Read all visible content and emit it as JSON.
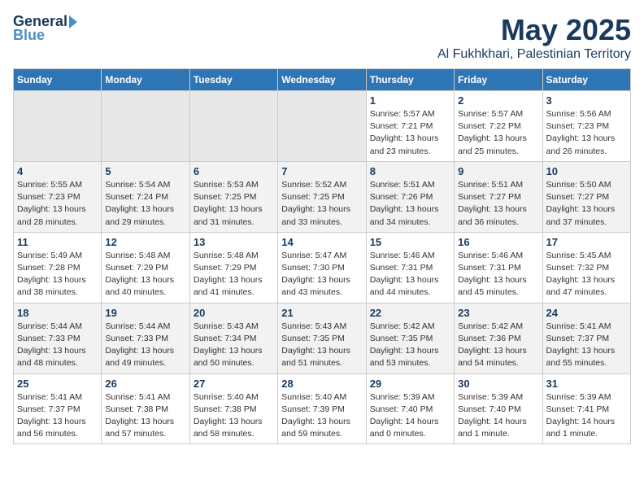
{
  "logo": {
    "general": "General",
    "blue": "Blue"
  },
  "title": "May 2025",
  "subtitle": "Al Fukhkhari, Palestinian Territory",
  "headers": [
    "Sunday",
    "Monday",
    "Tuesday",
    "Wednesday",
    "Thursday",
    "Friday",
    "Saturday"
  ],
  "weeks": [
    [
      {
        "day": "",
        "info": ""
      },
      {
        "day": "",
        "info": ""
      },
      {
        "day": "",
        "info": ""
      },
      {
        "day": "",
        "info": ""
      },
      {
        "day": "1",
        "info": "Sunrise: 5:57 AM\nSunset: 7:21 PM\nDaylight: 13 hours\nand 23 minutes."
      },
      {
        "day": "2",
        "info": "Sunrise: 5:57 AM\nSunset: 7:22 PM\nDaylight: 13 hours\nand 25 minutes."
      },
      {
        "day": "3",
        "info": "Sunrise: 5:56 AM\nSunset: 7:23 PM\nDaylight: 13 hours\nand 26 minutes."
      }
    ],
    [
      {
        "day": "4",
        "info": "Sunrise: 5:55 AM\nSunset: 7:23 PM\nDaylight: 13 hours\nand 28 minutes."
      },
      {
        "day": "5",
        "info": "Sunrise: 5:54 AM\nSunset: 7:24 PM\nDaylight: 13 hours\nand 29 minutes."
      },
      {
        "day": "6",
        "info": "Sunrise: 5:53 AM\nSunset: 7:25 PM\nDaylight: 13 hours\nand 31 minutes."
      },
      {
        "day": "7",
        "info": "Sunrise: 5:52 AM\nSunset: 7:25 PM\nDaylight: 13 hours\nand 33 minutes."
      },
      {
        "day": "8",
        "info": "Sunrise: 5:51 AM\nSunset: 7:26 PM\nDaylight: 13 hours\nand 34 minutes."
      },
      {
        "day": "9",
        "info": "Sunrise: 5:51 AM\nSunset: 7:27 PM\nDaylight: 13 hours\nand 36 minutes."
      },
      {
        "day": "10",
        "info": "Sunrise: 5:50 AM\nSunset: 7:27 PM\nDaylight: 13 hours\nand 37 minutes."
      }
    ],
    [
      {
        "day": "11",
        "info": "Sunrise: 5:49 AM\nSunset: 7:28 PM\nDaylight: 13 hours\nand 38 minutes."
      },
      {
        "day": "12",
        "info": "Sunrise: 5:48 AM\nSunset: 7:29 PM\nDaylight: 13 hours\nand 40 minutes."
      },
      {
        "day": "13",
        "info": "Sunrise: 5:48 AM\nSunset: 7:29 PM\nDaylight: 13 hours\nand 41 minutes."
      },
      {
        "day": "14",
        "info": "Sunrise: 5:47 AM\nSunset: 7:30 PM\nDaylight: 13 hours\nand 43 minutes."
      },
      {
        "day": "15",
        "info": "Sunrise: 5:46 AM\nSunset: 7:31 PM\nDaylight: 13 hours\nand 44 minutes."
      },
      {
        "day": "16",
        "info": "Sunrise: 5:46 AM\nSunset: 7:31 PM\nDaylight: 13 hours\nand 45 minutes."
      },
      {
        "day": "17",
        "info": "Sunrise: 5:45 AM\nSunset: 7:32 PM\nDaylight: 13 hours\nand 47 minutes."
      }
    ],
    [
      {
        "day": "18",
        "info": "Sunrise: 5:44 AM\nSunset: 7:33 PM\nDaylight: 13 hours\nand 48 minutes."
      },
      {
        "day": "19",
        "info": "Sunrise: 5:44 AM\nSunset: 7:33 PM\nDaylight: 13 hours\nand 49 minutes."
      },
      {
        "day": "20",
        "info": "Sunrise: 5:43 AM\nSunset: 7:34 PM\nDaylight: 13 hours\nand 50 minutes."
      },
      {
        "day": "21",
        "info": "Sunrise: 5:43 AM\nSunset: 7:35 PM\nDaylight: 13 hours\nand 51 minutes."
      },
      {
        "day": "22",
        "info": "Sunrise: 5:42 AM\nSunset: 7:35 PM\nDaylight: 13 hours\nand 53 minutes."
      },
      {
        "day": "23",
        "info": "Sunrise: 5:42 AM\nSunset: 7:36 PM\nDaylight: 13 hours\nand 54 minutes."
      },
      {
        "day": "24",
        "info": "Sunrise: 5:41 AM\nSunset: 7:37 PM\nDaylight: 13 hours\nand 55 minutes."
      }
    ],
    [
      {
        "day": "25",
        "info": "Sunrise: 5:41 AM\nSunset: 7:37 PM\nDaylight: 13 hours\nand 56 minutes."
      },
      {
        "day": "26",
        "info": "Sunrise: 5:41 AM\nSunset: 7:38 PM\nDaylight: 13 hours\nand 57 minutes."
      },
      {
        "day": "27",
        "info": "Sunrise: 5:40 AM\nSunset: 7:38 PM\nDaylight: 13 hours\nand 58 minutes."
      },
      {
        "day": "28",
        "info": "Sunrise: 5:40 AM\nSunset: 7:39 PM\nDaylight: 13 hours\nand 59 minutes."
      },
      {
        "day": "29",
        "info": "Sunrise: 5:39 AM\nSunset: 7:40 PM\nDaylight: 14 hours\nand 0 minutes."
      },
      {
        "day": "30",
        "info": "Sunrise: 5:39 AM\nSunset: 7:40 PM\nDaylight: 14 hours\nand 1 minute."
      },
      {
        "day": "31",
        "info": "Sunrise: 5:39 AM\nSunset: 7:41 PM\nDaylight: 14 hours\nand 1 minute."
      }
    ]
  ]
}
